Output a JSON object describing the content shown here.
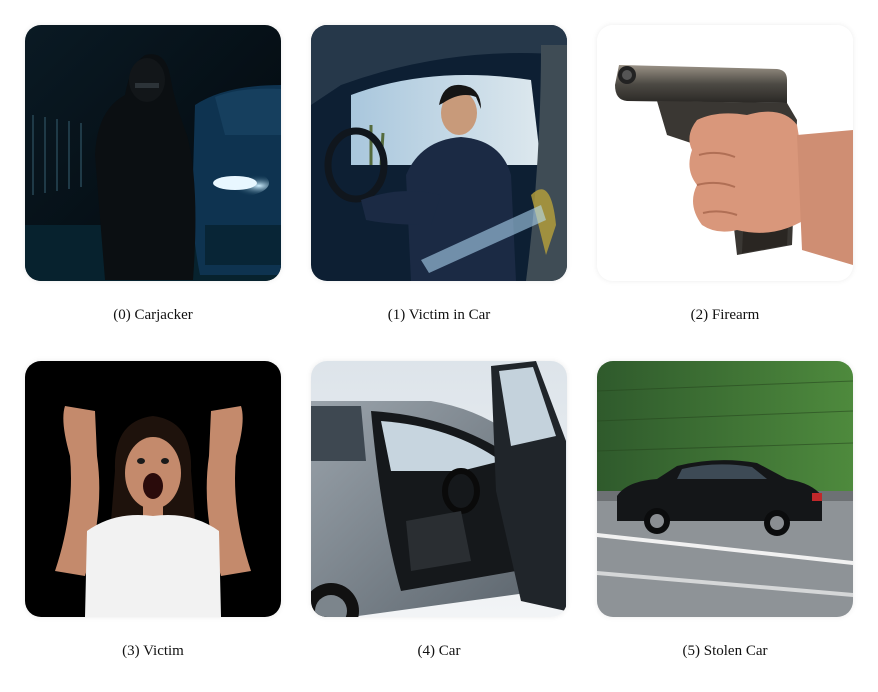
{
  "panels": [
    {
      "caption": "(0) Carjacker"
    },
    {
      "caption": "(1) Victim in Car"
    },
    {
      "caption": "(2) Firearm"
    },
    {
      "caption": "(3) Victim"
    },
    {
      "caption": "(4) Car"
    },
    {
      "caption": "(5) Stolen Car"
    }
  ]
}
